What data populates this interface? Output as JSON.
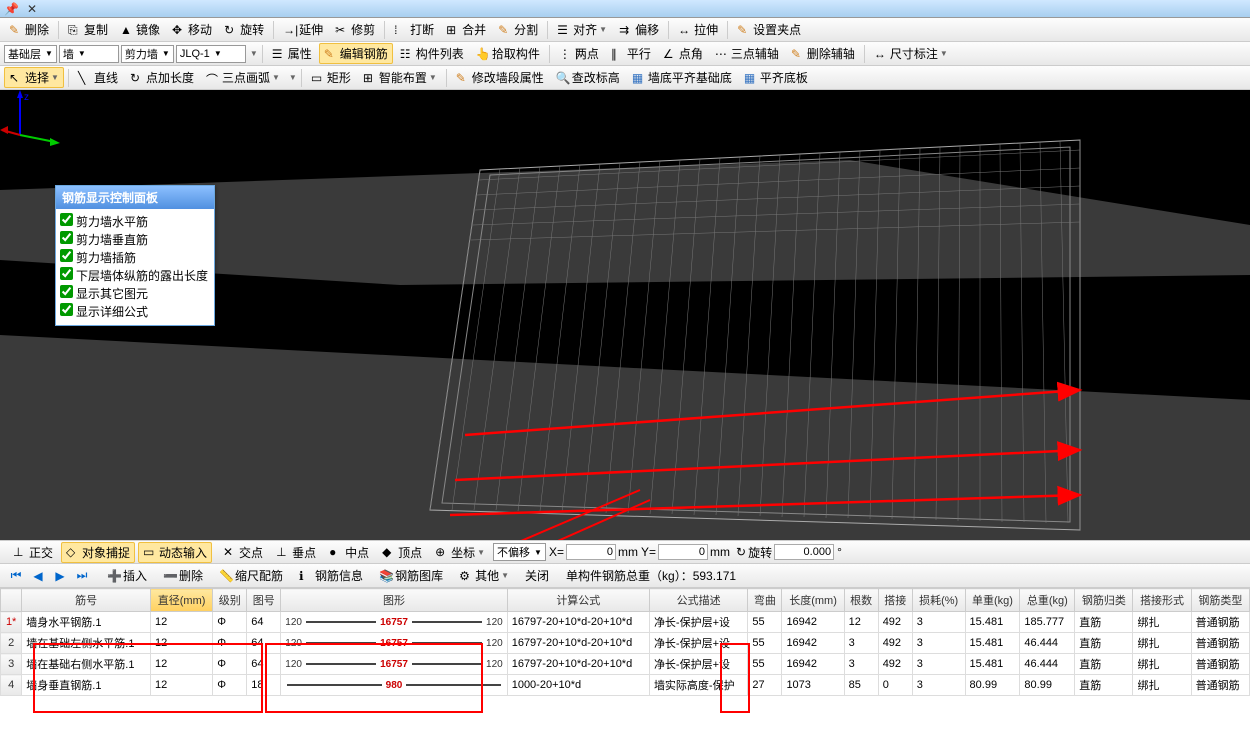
{
  "titlebar": {
    "pin": "📌",
    "close": "✕"
  },
  "toolbar1": {
    "delete": "删除",
    "copy": "复制",
    "mirror": "镜像",
    "move": "移动",
    "rotate": "旋转",
    "extend": "延伸",
    "trim": "修剪",
    "break": "打断",
    "merge": "合并",
    "split": "分割",
    "align": "对齐",
    "offset": "偏移",
    "stretch": "拉伸",
    "setgrip": "设置夹点"
  },
  "toolbar2": {
    "floor": "基础层",
    "wall": "墙",
    "shearwall": "剪力墙",
    "code": "JLQ-1",
    "props": "属性",
    "editbar": "编辑钢筋",
    "memberlist": "构件列表",
    "pick": "拾取构件",
    "twopoint": "两点",
    "parallel": "平行",
    "pointangle": "点角",
    "threepoint": "三点辅轴",
    "delaux": "删除辅轴",
    "dim": "尺寸标注"
  },
  "toolbar3": {
    "select": "选择",
    "line": "直线",
    "addlen": "点加长度",
    "arc3": "三点画弧",
    "rect": "矩形",
    "autoarr": "智能布置",
    "editseg": "修改墙段属性",
    "chkelev": "查改标高",
    "btmflush": "墙底平齐基础底",
    "flushbtm": "平齐底板"
  },
  "panel": {
    "title": "钢筋显示控制面板",
    "items": [
      "剪力墙水平筋",
      "剪力墙垂直筋",
      "剪力墙插筋",
      "下层墙体纵筋的露出长度",
      "显示其它图元",
      "显示详细公式"
    ]
  },
  "statusbar": {
    "ortho": "正交",
    "osnap": "对象捕捉",
    "dyninput": "动态输入",
    "cross": "交点",
    "perp": "垂点",
    "mid": "中点",
    "vert": "顶点",
    "coord": "坐标",
    "nooffset": "不偏移",
    "x": "X=",
    "y": "Y=",
    "mm": "mm",
    "rot": "旋转",
    "rotval": "0.000"
  },
  "actionbar": {
    "insert": "插入",
    "delete": "删除",
    "scalebar": "缩尺配筋",
    "barinfo": "钢筋信息",
    "barlib": "钢筋图库",
    "other": "其他",
    "close": "关闭",
    "totalweight": "单构件钢筋总重（kg）：593.171"
  },
  "table": {
    "headers": [
      "",
      "筋号",
      "直径(mm)",
      "级别",
      "图号",
      "图形",
      "计算公式",
      "公式描述",
      "弯曲",
      "长度(mm)",
      "根数",
      "搭接",
      "损耗(%)",
      "单重(kg)",
      "总重(kg)",
      "钢筋归类",
      "搭接形式",
      "钢筋类型"
    ],
    "rows": [
      {
        "n": "1*",
        "name": "墙身水平钢筋.1",
        "dia": "12",
        "grade": "Φ",
        "fig": "64",
        "sL": "120",
        "sM": "16757",
        "sR": "120",
        "formula": "16797-20+10*d-20+10*d",
        "desc": "净长-保护层+设",
        "bend": "55",
        "len": "16942",
        "qty": "12",
        "lap": "492",
        "loss": "3",
        "uw": "15.481",
        "tw": "185.777",
        "cat": "直筋",
        "laptype": "绑扎",
        "type": "普通钢筋"
      },
      {
        "n": "2",
        "name": "墙在基础左侧水平筋.1",
        "dia": "12",
        "grade": "Φ",
        "fig": "64",
        "sL": "120",
        "sM": "16757",
        "sR": "120",
        "formula": "16797-20+10*d-20+10*d",
        "desc": "净长-保护层+设",
        "bend": "55",
        "len": "16942",
        "qty": "3",
        "lap": "492",
        "loss": "3",
        "uw": "15.481",
        "tw": "46.444",
        "cat": "直筋",
        "laptype": "绑扎",
        "type": "普通钢筋"
      },
      {
        "n": "3",
        "name": "墙在基础右侧水平筋.1",
        "dia": "12",
        "grade": "Φ",
        "fig": "64",
        "sL": "120",
        "sM": "16757",
        "sR": "120",
        "formula": "16797-20+10*d-20+10*d",
        "desc": "净长-保护层+设",
        "bend": "55",
        "len": "16942",
        "qty": "3",
        "lap": "492",
        "loss": "3",
        "uw": "15.481",
        "tw": "46.444",
        "cat": "直筋",
        "laptype": "绑扎",
        "type": "普通钢筋"
      },
      {
        "n": "4",
        "name": "墙身垂直钢筋.1",
        "dia": "12",
        "grade": "Φ",
        "fig": "18",
        "sL": "",
        "sM": "980",
        "sR": "",
        "formula": "1000-20+10*d",
        "desc": "墙实际高度-保护",
        "bend": "27",
        "len": "1073",
        "qty": "85",
        "lap": "0",
        "loss": "3",
        "uw": "80.99",
        "tw": "80.99",
        "cat": "直筋",
        "laptype": "绑扎",
        "type": "普通钢筋"
      }
    ]
  }
}
